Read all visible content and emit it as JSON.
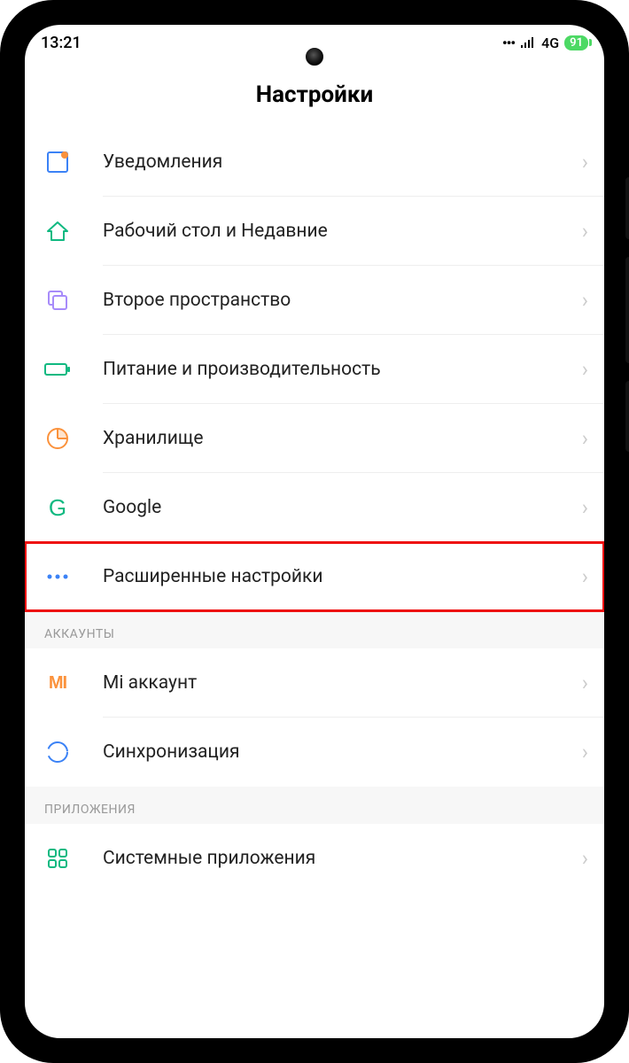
{
  "status": {
    "time": "13:21",
    "network": "4G",
    "battery": "91"
  },
  "header": {
    "title": "Настройки"
  },
  "group1": {
    "items": [
      {
        "id": "notifications",
        "label": "Уведомления",
        "icon": "notification-icon",
        "color": "#3b82f6"
      },
      {
        "id": "home",
        "label": "Рабочий стол и Недавние",
        "icon": "home-icon",
        "color": "#10b981"
      },
      {
        "id": "second-space",
        "label": "Второе пространство",
        "icon": "copy-icon",
        "color": "#a78bfa"
      },
      {
        "id": "power",
        "label": "Питание и производительность",
        "icon": "battery-icon",
        "color": "#10b981"
      },
      {
        "id": "storage",
        "label": "Хранилище",
        "icon": "pie-icon",
        "color": "#fb923c"
      },
      {
        "id": "google",
        "label": "Google",
        "icon": "google-icon",
        "color": "#10b981"
      },
      {
        "id": "advanced",
        "label": "Расширенные настройки",
        "icon": "dots-icon",
        "color": "#3b82f6",
        "highlight": true
      }
    ]
  },
  "group2": {
    "title": "АККАУНТЫ",
    "items": [
      {
        "id": "mi-account",
        "label": "Mi аккаунт",
        "icon": "mi-icon",
        "color": "#fb923c"
      },
      {
        "id": "sync",
        "label": "Синхронизация",
        "icon": "sync-icon",
        "color": "#3b82f6"
      }
    ]
  },
  "group3": {
    "title": "ПРИЛОЖЕНИЯ",
    "items": [
      {
        "id": "system-apps",
        "label": "Системные приложения",
        "icon": "grid-icon",
        "color": "#10b981"
      }
    ]
  }
}
